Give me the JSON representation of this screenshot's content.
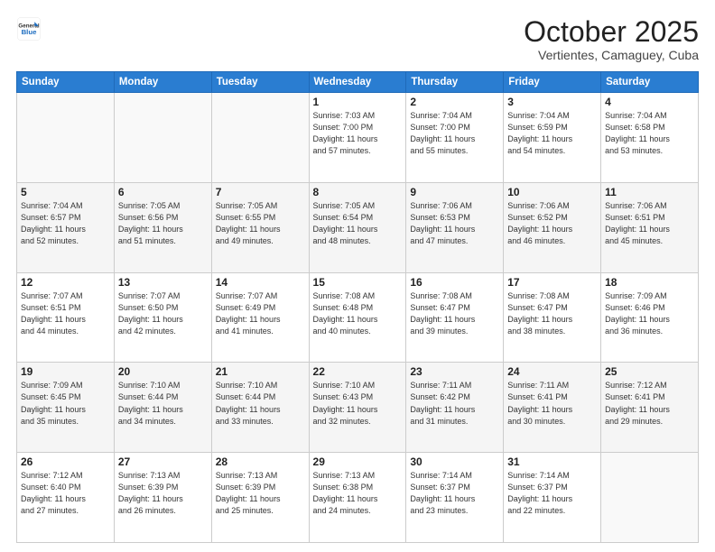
{
  "header": {
    "logo_general": "General",
    "logo_blue": "Blue",
    "month": "October 2025",
    "location": "Vertientes, Camaguey, Cuba"
  },
  "days_of_week": [
    "Sunday",
    "Monday",
    "Tuesday",
    "Wednesday",
    "Thursday",
    "Friday",
    "Saturday"
  ],
  "weeks": [
    [
      {
        "day": "",
        "info": ""
      },
      {
        "day": "",
        "info": ""
      },
      {
        "day": "",
        "info": ""
      },
      {
        "day": "1",
        "info": "Sunrise: 7:03 AM\nSunset: 7:00 PM\nDaylight: 11 hours\nand 57 minutes."
      },
      {
        "day": "2",
        "info": "Sunrise: 7:04 AM\nSunset: 7:00 PM\nDaylight: 11 hours\nand 55 minutes."
      },
      {
        "day": "3",
        "info": "Sunrise: 7:04 AM\nSunset: 6:59 PM\nDaylight: 11 hours\nand 54 minutes."
      },
      {
        "day": "4",
        "info": "Sunrise: 7:04 AM\nSunset: 6:58 PM\nDaylight: 11 hours\nand 53 minutes."
      }
    ],
    [
      {
        "day": "5",
        "info": "Sunrise: 7:04 AM\nSunset: 6:57 PM\nDaylight: 11 hours\nand 52 minutes."
      },
      {
        "day": "6",
        "info": "Sunrise: 7:05 AM\nSunset: 6:56 PM\nDaylight: 11 hours\nand 51 minutes."
      },
      {
        "day": "7",
        "info": "Sunrise: 7:05 AM\nSunset: 6:55 PM\nDaylight: 11 hours\nand 49 minutes."
      },
      {
        "day": "8",
        "info": "Sunrise: 7:05 AM\nSunset: 6:54 PM\nDaylight: 11 hours\nand 48 minutes."
      },
      {
        "day": "9",
        "info": "Sunrise: 7:06 AM\nSunset: 6:53 PM\nDaylight: 11 hours\nand 47 minutes."
      },
      {
        "day": "10",
        "info": "Sunrise: 7:06 AM\nSunset: 6:52 PM\nDaylight: 11 hours\nand 46 minutes."
      },
      {
        "day": "11",
        "info": "Sunrise: 7:06 AM\nSunset: 6:51 PM\nDaylight: 11 hours\nand 45 minutes."
      }
    ],
    [
      {
        "day": "12",
        "info": "Sunrise: 7:07 AM\nSunset: 6:51 PM\nDaylight: 11 hours\nand 44 minutes."
      },
      {
        "day": "13",
        "info": "Sunrise: 7:07 AM\nSunset: 6:50 PM\nDaylight: 11 hours\nand 42 minutes."
      },
      {
        "day": "14",
        "info": "Sunrise: 7:07 AM\nSunset: 6:49 PM\nDaylight: 11 hours\nand 41 minutes."
      },
      {
        "day": "15",
        "info": "Sunrise: 7:08 AM\nSunset: 6:48 PM\nDaylight: 11 hours\nand 40 minutes."
      },
      {
        "day": "16",
        "info": "Sunrise: 7:08 AM\nSunset: 6:47 PM\nDaylight: 11 hours\nand 39 minutes."
      },
      {
        "day": "17",
        "info": "Sunrise: 7:08 AM\nSunset: 6:47 PM\nDaylight: 11 hours\nand 38 minutes."
      },
      {
        "day": "18",
        "info": "Sunrise: 7:09 AM\nSunset: 6:46 PM\nDaylight: 11 hours\nand 36 minutes."
      }
    ],
    [
      {
        "day": "19",
        "info": "Sunrise: 7:09 AM\nSunset: 6:45 PM\nDaylight: 11 hours\nand 35 minutes."
      },
      {
        "day": "20",
        "info": "Sunrise: 7:10 AM\nSunset: 6:44 PM\nDaylight: 11 hours\nand 34 minutes."
      },
      {
        "day": "21",
        "info": "Sunrise: 7:10 AM\nSunset: 6:44 PM\nDaylight: 11 hours\nand 33 minutes."
      },
      {
        "day": "22",
        "info": "Sunrise: 7:10 AM\nSunset: 6:43 PM\nDaylight: 11 hours\nand 32 minutes."
      },
      {
        "day": "23",
        "info": "Sunrise: 7:11 AM\nSunset: 6:42 PM\nDaylight: 11 hours\nand 31 minutes."
      },
      {
        "day": "24",
        "info": "Sunrise: 7:11 AM\nSunset: 6:41 PM\nDaylight: 11 hours\nand 30 minutes."
      },
      {
        "day": "25",
        "info": "Sunrise: 7:12 AM\nSunset: 6:41 PM\nDaylight: 11 hours\nand 29 minutes."
      }
    ],
    [
      {
        "day": "26",
        "info": "Sunrise: 7:12 AM\nSunset: 6:40 PM\nDaylight: 11 hours\nand 27 minutes."
      },
      {
        "day": "27",
        "info": "Sunrise: 7:13 AM\nSunset: 6:39 PM\nDaylight: 11 hours\nand 26 minutes."
      },
      {
        "day": "28",
        "info": "Sunrise: 7:13 AM\nSunset: 6:39 PM\nDaylight: 11 hours\nand 25 minutes."
      },
      {
        "day": "29",
        "info": "Sunrise: 7:13 AM\nSunset: 6:38 PM\nDaylight: 11 hours\nand 24 minutes."
      },
      {
        "day": "30",
        "info": "Sunrise: 7:14 AM\nSunset: 6:37 PM\nDaylight: 11 hours\nand 23 minutes."
      },
      {
        "day": "31",
        "info": "Sunrise: 7:14 AM\nSunset: 6:37 PM\nDaylight: 11 hours\nand 22 minutes."
      },
      {
        "day": "",
        "info": ""
      }
    ]
  ]
}
